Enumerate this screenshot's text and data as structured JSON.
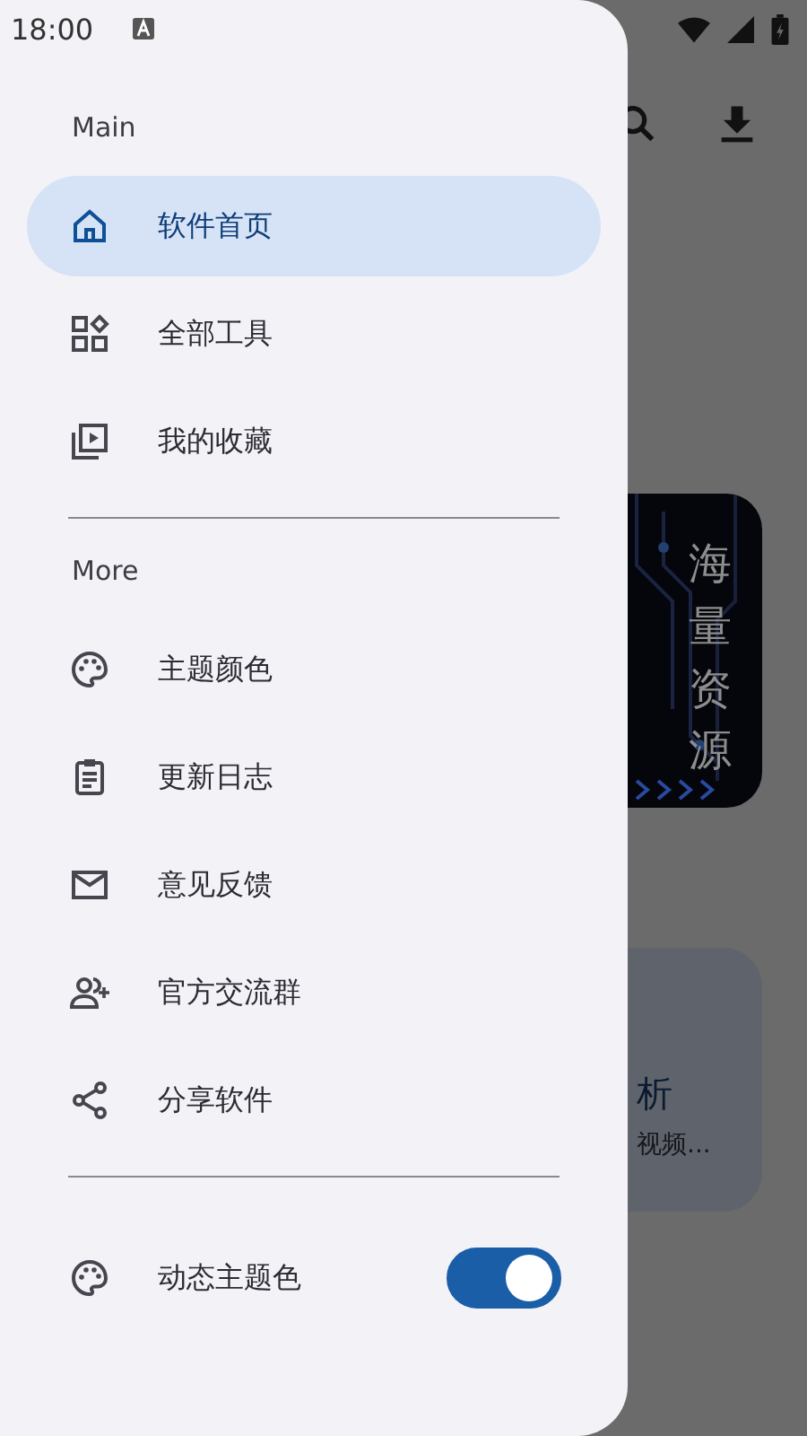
{
  "status_bar": {
    "time": "18:00"
  },
  "background": {
    "banner_text": "海量资源",
    "card_title": "析",
    "card_subtitle": "视频..."
  },
  "drawer": {
    "sections": [
      {
        "title": "Main",
        "items": [
          {
            "label": "软件首页",
            "selected": true
          },
          {
            "label": "全部工具",
            "selected": false
          },
          {
            "label": "我的收藏",
            "selected": false
          }
        ]
      },
      {
        "title": "More",
        "items": [
          {
            "label": "主题颜色",
            "selected": false
          },
          {
            "label": "更新日志",
            "selected": false
          },
          {
            "label": "意见反馈",
            "selected": false
          },
          {
            "label": "官方交流群",
            "selected": false
          },
          {
            "label": "分享软件",
            "selected": false
          }
        ]
      }
    ],
    "settings": [
      {
        "label": "动态主题色",
        "kind": "switch",
        "on": true
      }
    ]
  }
}
